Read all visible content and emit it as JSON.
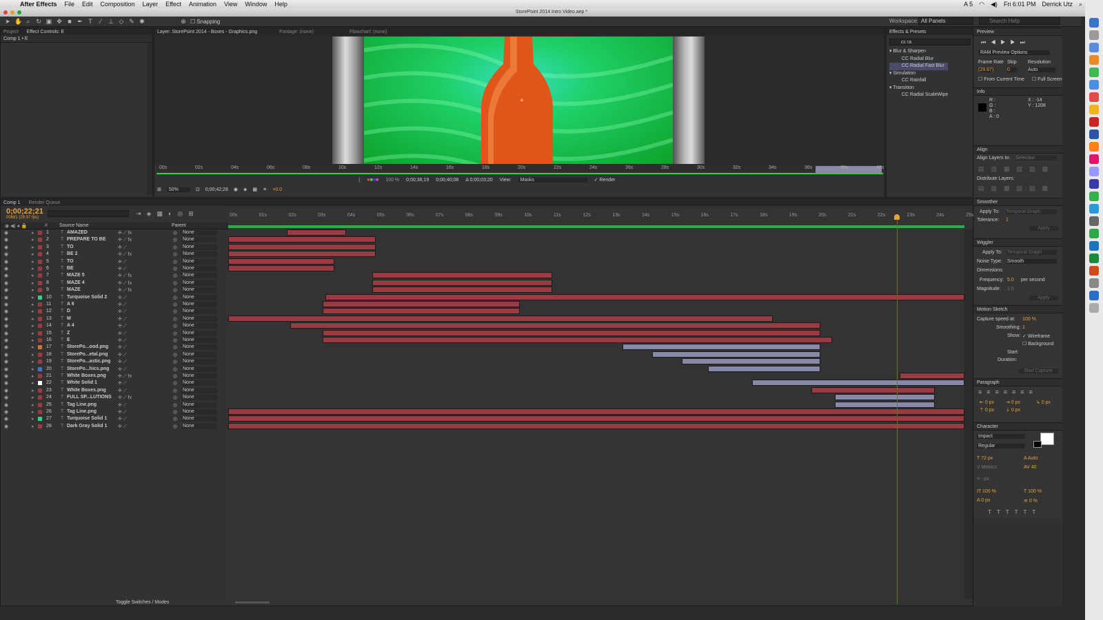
{
  "menubar": {
    "apple": "",
    "app": "After Effects",
    "items": [
      "File",
      "Edit",
      "Composition",
      "Layer",
      "Effect",
      "Animation",
      "View",
      "Window",
      "Help"
    ],
    "clock": "Fri 6:01 PM",
    "user": "Derrick Utz",
    "badge": "5"
  },
  "window_title": "StorePoint 2014 Intro Video.aep *",
  "toolbar": {
    "snapping": "Snapping",
    "workspace_label": "Workspace:",
    "workspace_value": "All Panels",
    "search_placeholder": "Search Help"
  },
  "project_panel": {
    "tabs": [
      "Project",
      "Effect Controls: E"
    ],
    "breadcrumb": "Comp 1 • E"
  },
  "viewer": {
    "tab": "Layer: StorePoint 2014 - Boxes - Graphics.png",
    "footage": "Footage: (none)",
    "flowchart": "Flowchart: (none)",
    "ruler": [
      "00s",
      "02s",
      "04s",
      "06s",
      "08s",
      "10s",
      "12s",
      "14s",
      "16s",
      "18s",
      "20s",
      "22s",
      "24s",
      "26s",
      "28s",
      "30s",
      "32s",
      "34s",
      "36s",
      "38s",
      "40s"
    ],
    "zoom": "50%",
    "timecode": "0;00;42;28",
    "opacity": "100 %",
    "in_point": "0;00;36;19",
    "out_point": "0;00;40;08",
    "duration": "Δ 0;00;03;20",
    "view_label": "View:",
    "view_value": "Masks",
    "render": "Render",
    "exposure": "+0.0"
  },
  "effects": {
    "tab": "Effects & Presets",
    "search": "cc ra",
    "groups": [
      {
        "name": "Blur & Sharpen",
        "items": [
          "CC Radial Blur",
          "CC Radial Fast Blur"
        ]
      },
      {
        "name": "Simulation",
        "items": [
          "CC Rainfall"
        ]
      },
      {
        "name": "Transition",
        "items": [
          "CC Radial ScaleWipe"
        ]
      }
    ]
  },
  "preview": {
    "tab": "Preview",
    "options": "RAM Preview Options",
    "frame_rate": "Frame Rate",
    "skip": "Skip",
    "resolution": "Resolution",
    "fr_val": "(29.97)",
    "skip_val": "0",
    "res_val": "Auto",
    "from_current": "From Current Time",
    "full_screen": "Full Screen"
  },
  "info": {
    "tab": "Info",
    "r": "R :",
    "g": "G :",
    "b": "B :",
    "a": "A : 0",
    "x": "X : -14",
    "y": "Y : 1208"
  },
  "align": {
    "tab": "Align",
    "align_to": "Align Layers to:",
    "selection": "Selection",
    "distribute": "Distribute Layers:"
  },
  "smoother": {
    "tab": "Smoother",
    "apply_to": "Apply To:",
    "apply_val": "Temporal Graph",
    "tolerance": "Tolerance:",
    "tol_val": "1",
    "apply": "Apply"
  },
  "wiggler": {
    "tab": "Wiggler",
    "apply_to": "Apply To:",
    "apply_val": "Temporal Graph",
    "noise": "Noise Type:",
    "noise_val": "Smooth",
    "dimensions": "Dimensions:",
    "frequency": "Frequency:",
    "freq_val": "5.0",
    "per_second": "per second",
    "magnitude": "Magnitude:",
    "mag_val": "1.0",
    "apply": "Apply"
  },
  "motion_sketch": {
    "tab": "Motion Sketch",
    "capture": "Capture speed at:",
    "capture_val": "100 %",
    "smoothing": "Smoothing:",
    "smooth_val": "1",
    "show": "Show:",
    "wireframe": "Wireframe",
    "background": "Background",
    "start": "Start:",
    "duration": "Duration:",
    "start_capture": "Start Capture"
  },
  "paragraph": {
    "tab": "Paragraph",
    "px1": "0 px",
    "px2": "0 px",
    "px3": "0 px",
    "px4": "0 px",
    "px5": "0 px"
  },
  "character": {
    "tab": "Character",
    "font": "Impact",
    "style": "Regular",
    "size": "72 px",
    "leading": "Auto",
    "kerning": "Metrics",
    "tracking": "40",
    "stroke": "- px",
    "vscale": "100 %",
    "hscale": "100 %",
    "baseline": "0 px",
    "tsume": "0 %"
  },
  "timeline": {
    "tabs": [
      "Comp 1",
      "Render Queue"
    ],
    "timecode": "0;00;22;21",
    "fps": "00681 (29.97 fps)",
    "col_source": "Source Name",
    "col_parent": "Parent",
    "ruler": [
      "00s",
      "01s",
      "02s",
      "03s",
      "04s",
      "05s",
      "06s",
      "07s",
      "08s",
      "09s",
      "10s",
      "11s",
      "12s",
      "13s",
      "14s",
      "15s",
      "16s",
      "17s",
      "18s",
      "19s",
      "20s",
      "21s",
      "22s",
      "23s",
      "24s",
      "25s"
    ],
    "toggle": "Toggle Switches / Modes",
    "parent_default": "None",
    "layers": [
      {
        "n": "1",
        "name": "AMAZED",
        "fx": true,
        "color": "#9b3a42",
        "bars": [
          [
            2,
            4
          ]
        ],
        "kind": "red"
      },
      {
        "n": "2",
        "name": "PREPARE TO BE",
        "fx": true,
        "color": "#9b3a42",
        "bars": [
          [
            0,
            5
          ]
        ],
        "kind": "red"
      },
      {
        "n": "3",
        "name": "TO",
        "fx": false,
        "color": "#9b3a42",
        "bars": [
          [
            0,
            5
          ]
        ],
        "kind": "red"
      },
      {
        "n": "4",
        "name": "BE 2",
        "fx": true,
        "color": "#9b3a42",
        "bars": [
          [
            0,
            5
          ]
        ],
        "kind": "red"
      },
      {
        "n": "5",
        "name": "TO",
        "fx": false,
        "color": "#9b3a42",
        "bars": [
          [
            0,
            3.6
          ]
        ],
        "kind": "red"
      },
      {
        "n": "6",
        "name": "BE",
        "fx": false,
        "color": "#9b3a42",
        "bars": [
          [
            0,
            3.6
          ]
        ],
        "kind": "red"
      },
      {
        "n": "7",
        "name": "MAZE 5",
        "fx": true,
        "color": "#9b3a42",
        "bars": [
          [
            4.9,
            11
          ]
        ],
        "kind": "red"
      },
      {
        "n": "8",
        "name": "MAZE 4",
        "fx": true,
        "color": "#9b3a42",
        "bars": [
          [
            4.9,
            11
          ]
        ],
        "kind": "red"
      },
      {
        "n": "9",
        "name": "MAZE",
        "fx": true,
        "color": "#9b3a42",
        "bars": [
          [
            4.9,
            11
          ]
        ],
        "kind": "red"
      },
      {
        "n": "10",
        "name": "Turquoise Solid 2",
        "fx": false,
        "color": "#2fd08a",
        "bars": [
          [
            3.3,
            25
          ]
        ],
        "kind": "red"
      },
      {
        "n": "11",
        "name": "A 6",
        "fx": false,
        "color": "#9b3a42",
        "bars": [
          [
            3.2,
            9.9
          ]
        ],
        "kind": "red"
      },
      {
        "n": "12",
        "name": "D",
        "fx": false,
        "color": "#9b3a42",
        "bars": [
          [
            3.2,
            9.9
          ]
        ],
        "kind": "red"
      },
      {
        "n": "13",
        "name": "M",
        "fx": false,
        "color": "#9b3a42",
        "bars": [
          [
            0,
            18.5
          ]
        ],
        "kind": "red"
      },
      {
        "n": "14",
        "name": "A 4",
        "fx": false,
        "color": "#9b3a42",
        "bars": [
          [
            2.1,
            20.1
          ]
        ],
        "kind": "red"
      },
      {
        "n": "15",
        "name": "Z",
        "fx": false,
        "color": "#9b3a42",
        "bars": [
          [
            3.2,
            20.1
          ]
        ],
        "kind": "red"
      },
      {
        "n": "16",
        "name": "E",
        "fx": false,
        "color": "#9b3a42",
        "bars": [
          [
            3.2,
            20.5
          ]
        ],
        "kind": "red"
      },
      {
        "n": "17",
        "name": "StorePo...ood.png",
        "fx": false,
        "color": "#c87a3a",
        "bars": [
          [
            13.4,
            20.1
          ]
        ],
        "kind": "lav"
      },
      {
        "n": "18",
        "name": "StorePo...etal.png",
        "fx": false,
        "color": "#9b3a42",
        "bars": [
          [
            14.4,
            20.1
          ]
        ],
        "kind": "lav"
      },
      {
        "n": "19",
        "name": "StorePo...astic.png",
        "fx": false,
        "color": "#9b3a42",
        "bars": [
          [
            15.4,
            20.1
          ]
        ],
        "kind": "lav"
      },
      {
        "n": "20",
        "name": "StorePo...hics.png",
        "fx": false,
        "color": "#3a7ac8",
        "bars": [
          [
            16.3,
            20.1
          ]
        ],
        "kind": "lav"
      },
      {
        "n": "21",
        "name": "White Boxes.png",
        "fx": true,
        "color": "#9b3a42",
        "bars": [
          [
            22.8,
            25
          ]
        ],
        "kind": "red"
      },
      {
        "n": "22",
        "name": "White Solid 1",
        "fx": false,
        "color": "#ffffff",
        "bars": [
          [
            17.8,
            25
          ]
        ],
        "kind": "lav"
      },
      {
        "n": "23",
        "name": "White Boxes.png",
        "fx": false,
        "color": "#9b3a42",
        "bars": [
          [
            19.8,
            24
          ]
        ],
        "kind": "red"
      },
      {
        "n": "24",
        "name": "FULL SP...LUTIONS",
        "fx": true,
        "color": "#9b3a42",
        "bars": [
          [
            20.6,
            24
          ]
        ],
        "kind": "lav"
      },
      {
        "n": "25",
        "name": "Tag Line.png",
        "fx": false,
        "color": "#9b3a42",
        "bars": [
          [
            20.6,
            24
          ]
        ],
        "kind": "lav"
      },
      {
        "n": "26",
        "name": "Tag Line.png",
        "fx": false,
        "color": "#9b3a42",
        "bars": [
          [
            0,
            25
          ]
        ],
        "kind": "red"
      },
      {
        "n": "27",
        "name": "Turquoise Solid 1",
        "fx": false,
        "color": "#2fd08a",
        "bars": [
          [
            0,
            25
          ]
        ],
        "kind": "red"
      },
      {
        "n": "28",
        "name": "Dark Gray Solid 1",
        "fx": false,
        "color": "#9b3a42",
        "bars": [
          [
            0,
            25
          ]
        ],
        "kind": "red"
      }
    ]
  },
  "colors": {
    "accent": "#e9a13b",
    "layer_red": "#9b3a42",
    "layer_lav": "#8888a8",
    "green_bg": "#1fc23a",
    "bottle": "#e65a1e"
  }
}
